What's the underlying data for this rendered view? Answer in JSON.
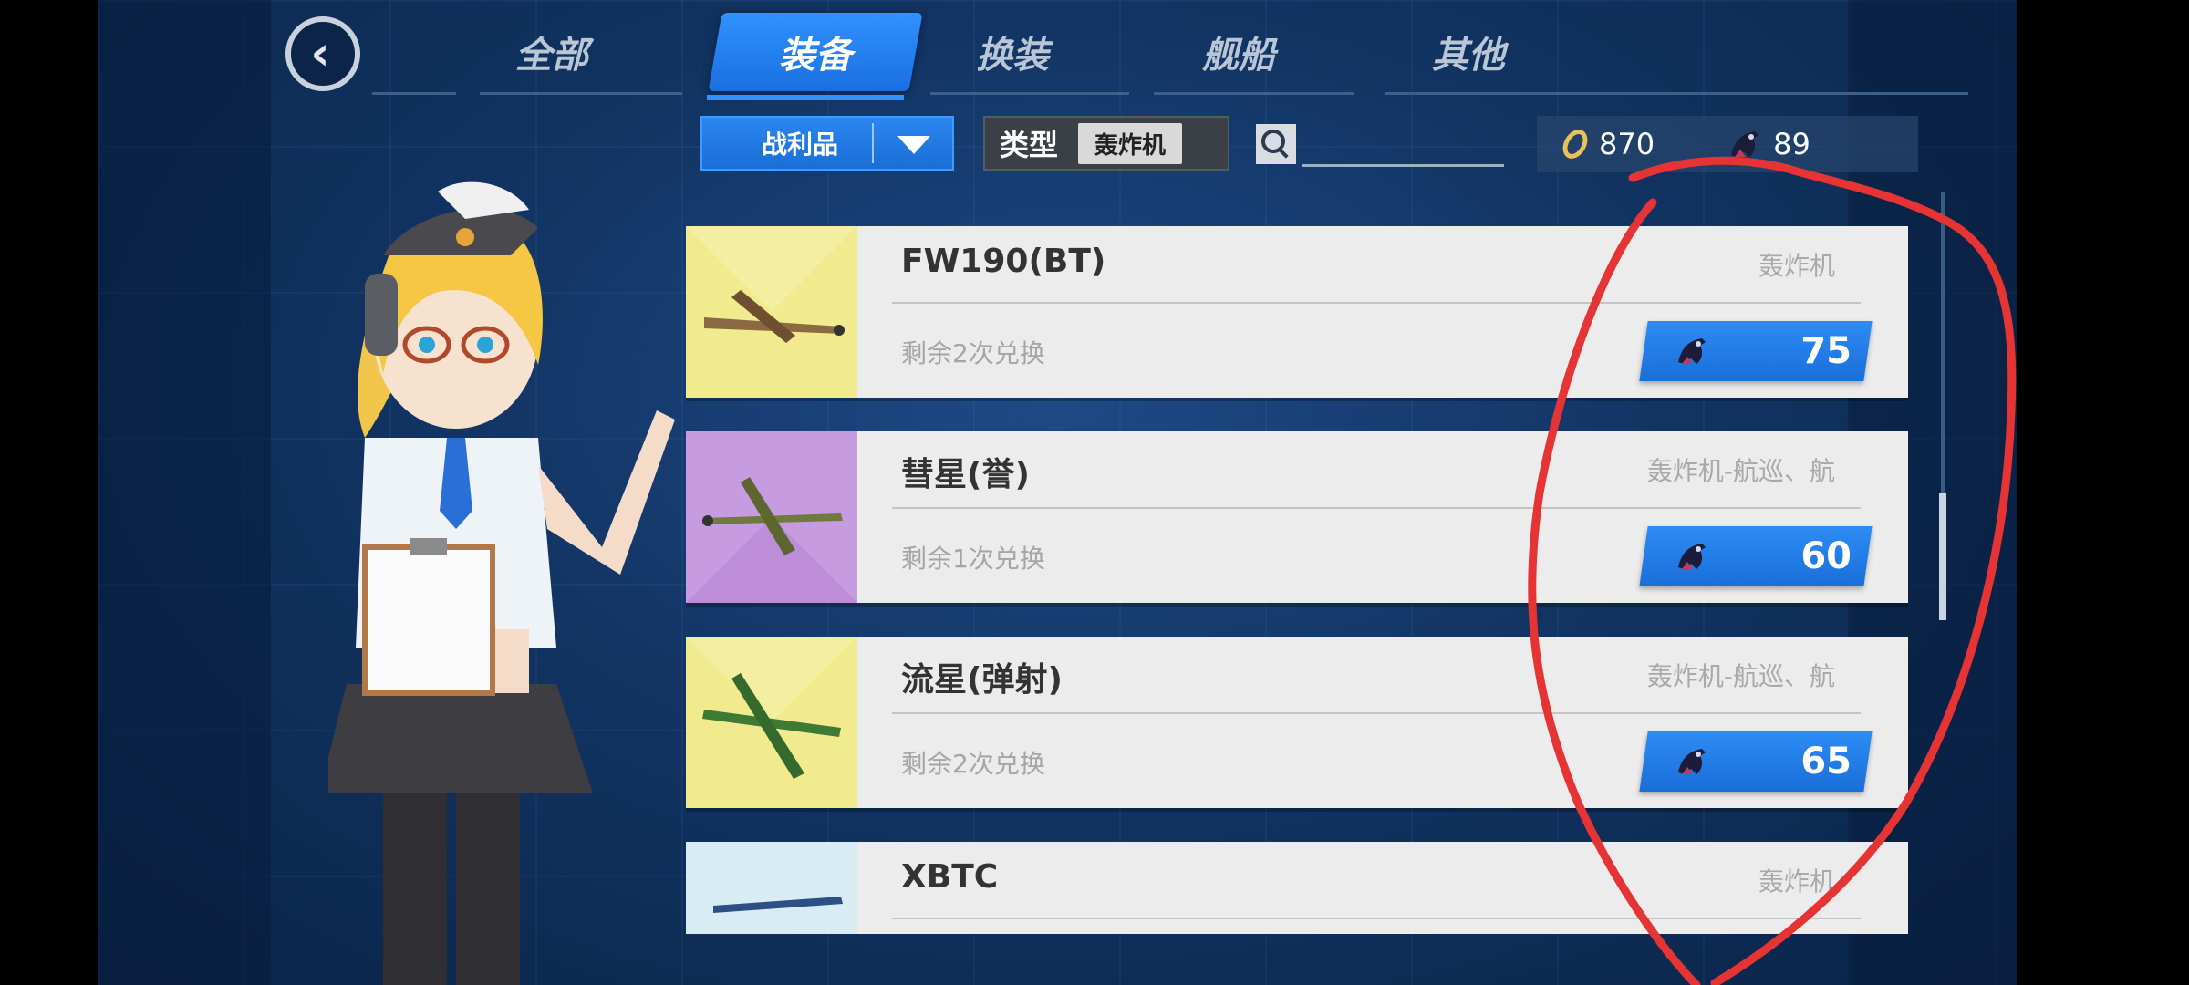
{
  "tabs": [
    {
      "label": "全部",
      "active": false
    },
    {
      "label": "装备",
      "active": true
    },
    {
      "label": "换装",
      "active": false
    },
    {
      "label": "舰船",
      "active": false
    },
    {
      "label": "其他",
      "active": false
    }
  ],
  "filter": {
    "dropdown_value": "战利品",
    "type_label": "类型",
    "type_value": "轰炸机",
    "search_value": ""
  },
  "currency": {
    "ring_amount": "870",
    "medal_amount": "89"
  },
  "items": [
    {
      "name": "FW190(BT)",
      "remaining": "剩余2次兑换",
      "type": "轰炸机",
      "price": "75",
      "bg": "yellow"
    },
    {
      "name": "彗星(誉)",
      "remaining": "剩余1次兑换",
      "type": "轰炸机-航巡、航",
      "price": "60",
      "bg": "purple"
    },
    {
      "name": "流星(弹射)",
      "remaining": "剩余2次兑换",
      "type": "轰炸机-航巡、航",
      "price": "65",
      "bg": "yellow"
    },
    {
      "name": "XBTC",
      "remaining": "",
      "type": "轰炸机",
      "price": "",
      "bg": "blue"
    }
  ],
  "colors": {
    "accent": "#2f92ff",
    "annotation": "#e63333"
  }
}
